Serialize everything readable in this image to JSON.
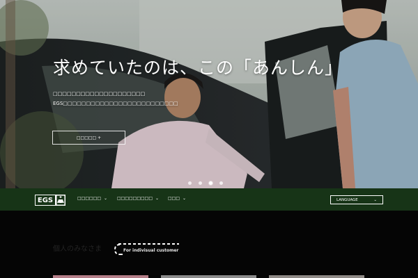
{
  "hero": {
    "title": "求めていたのは、この「あんしん」",
    "subtitle_line1": "□□□□□□□□□□□□□□□□□□□□",
    "subtitle_line2": "EGS□□□□□□□□□□□□□□□□□□□□□□□□□",
    "button_label": "□□□□□ +",
    "carousel": {
      "count": 4,
      "active_index": 2
    }
  },
  "nav": {
    "logo_text": "EGS",
    "menu_items": [
      {
        "label": "□□□□□□",
        "caret": "⌄"
      },
      {
        "label": "□□□□□□□□□",
        "caret": "⌄"
      },
      {
        "label": "□□□",
        "caret": "⌄"
      }
    ],
    "language": {
      "label": "LANGUAGE",
      "caret": "⌄"
    },
    "bar_color": "#173417"
  },
  "section": {
    "title_ja": "個人のみなさま",
    "title_en": "For indivisual customer"
  },
  "colors": {
    "accent": "#173417",
    "background": "#050505",
    "card_pink": "#b57e88",
    "card_gray": "#8b8b8b"
  }
}
